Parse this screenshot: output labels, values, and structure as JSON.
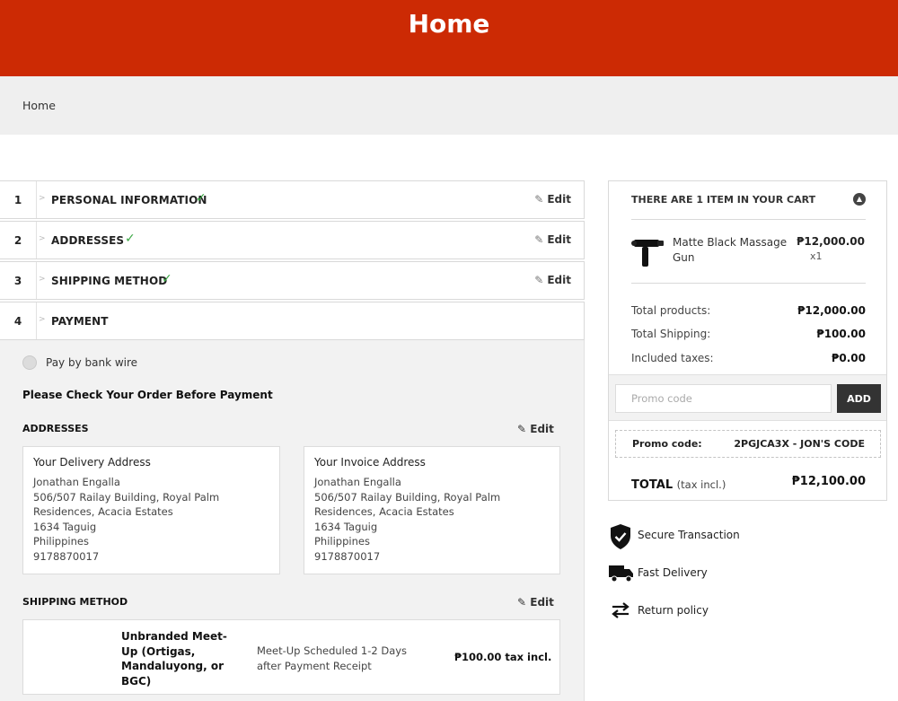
{
  "header": {
    "title": "Home"
  },
  "breadcrumb": {
    "label": "Home"
  },
  "steps": [
    {
      "number": "1",
      "title": "PERSONAL INFORMATION",
      "completed": true,
      "edit_label": "Edit"
    },
    {
      "number": "2",
      "title": "ADDRESSES",
      "completed": true,
      "edit_label": "Edit"
    },
    {
      "number": "3",
      "title": "SHIPPING METHOD",
      "completed": true,
      "edit_label": "Edit"
    },
    {
      "number": "4",
      "title": "PAYMENT",
      "completed": false
    }
  ],
  "payment": {
    "option_label": "Pay by bank wire",
    "check_heading": "Please Check Your Order Before Payment",
    "addresses": {
      "heading": "ADDRESSES",
      "edit_label": "Edit",
      "delivery": {
        "title": "Your Delivery Address",
        "lines": [
          "Jonathan Engalla",
          "506/507 Railay Building, Royal Palm",
          "Residences, Acacia Estates",
          "1634 Taguig",
          "Philippines",
          "9178870017"
        ]
      },
      "invoice": {
        "title": "Your Invoice Address",
        "lines": [
          "Jonathan Engalla",
          "506/507 Railay Building, Royal Palm",
          "Residences, Acacia Estates",
          "1634 Taguig",
          "Philippines",
          "9178870017"
        ]
      }
    },
    "shipping": {
      "heading": "SHIPPING METHOD",
      "edit_label": "Edit",
      "carrier_name": "Unbranded Meet-Up (Ortigas, Mandaluyong, or BGC)",
      "delay": "Meet-Up Scheduled 1-2 Days after Payment Receipt",
      "price": "₱100.00 tax incl."
    }
  },
  "cart": {
    "heading": "THERE ARE 1 ITEM IN YOUR CART",
    "toggle_icon": "collapse-icon",
    "product": {
      "name": "Matte Black Massage Gun",
      "price": "₱12,000.00",
      "quantity": "x1"
    },
    "totals": [
      {
        "label": "Total products:",
        "value": "₱12,000.00"
      },
      {
        "label": "Total Shipping:",
        "value": "₱100.00"
      },
      {
        "label": "Included taxes:",
        "value": "₱0.00"
      }
    ],
    "promo": {
      "placeholder": "Promo code",
      "add_label": "ADD",
      "applied_label": "Promo code:",
      "applied_value": "2PGJCA3X - JON'S CODE"
    },
    "total": {
      "label": "TOTAL",
      "note": "(tax incl.)",
      "value": "₱12,100.00"
    }
  },
  "reassurance": [
    {
      "icon": "shield-check-icon",
      "label": "Secure Transaction"
    },
    {
      "icon": "truck-icon",
      "label": "Fast Delivery"
    },
    {
      "icon": "swap-arrows-icon",
      "label": "Return policy"
    }
  ],
  "colors": {
    "brand": "#cc2a04",
    "check": "#3ca845"
  }
}
